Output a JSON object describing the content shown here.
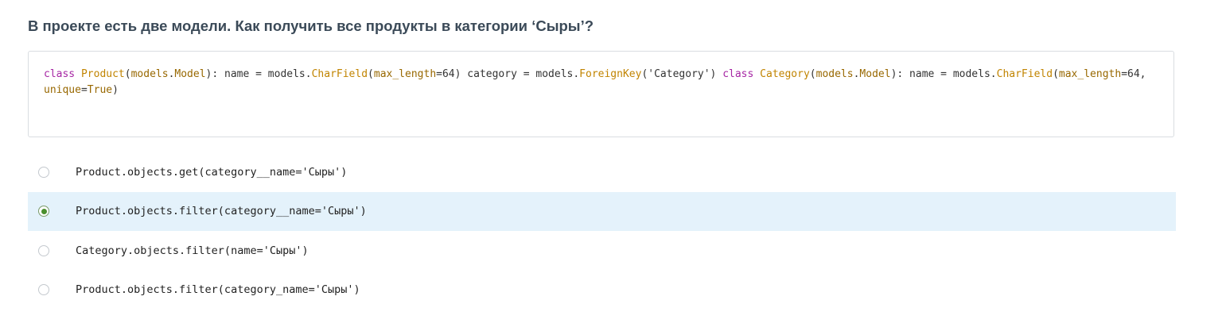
{
  "question": {
    "title": "В проекте есть две модели. Как получить все продукты в категории ‘Сыры’?"
  },
  "code": {
    "tokens": [
      {
        "t": "class",
        "k": "keyword"
      },
      {
        "t": " ",
        "k": "plain"
      },
      {
        "t": "Product",
        "k": "class"
      },
      {
        "t": "(",
        "k": "plain"
      },
      {
        "t": "models",
        "k": "module"
      },
      {
        "t": ".",
        "k": "plain"
      },
      {
        "t": "Model",
        "k": "module"
      },
      {
        "t": "): name = models.",
        "k": "plain"
      },
      {
        "t": "CharField",
        "k": "call"
      },
      {
        "t": "(",
        "k": "plain"
      },
      {
        "t": "max_length",
        "k": "param"
      },
      {
        "t": "=64) category = models.",
        "k": "plain"
      },
      {
        "t": "ForeignKey",
        "k": "call"
      },
      {
        "t": "('Category') ",
        "k": "plain"
      },
      {
        "t": "class",
        "k": "keyword"
      },
      {
        "t": " ",
        "k": "plain"
      },
      {
        "t": "Category",
        "k": "class"
      },
      {
        "t": "(",
        "k": "plain"
      },
      {
        "t": "models",
        "k": "module"
      },
      {
        "t": ".",
        "k": "plain"
      },
      {
        "t": "Model",
        "k": "module"
      },
      {
        "t": "): name = models.",
        "k": "plain"
      },
      {
        "t": "CharField",
        "k": "call"
      },
      {
        "t": "(",
        "k": "plain"
      },
      {
        "t": "max_length",
        "k": "param"
      },
      {
        "t": "=64, ",
        "k": "plain"
      },
      {
        "t": "unique",
        "k": "param"
      },
      {
        "t": "=",
        "k": "plain"
      },
      {
        "t": "True",
        "k": "module"
      },
      {
        "t": ")",
        "k": "plain"
      }
    ]
  },
  "options": [
    {
      "label": "Product.objects.get(category__name='Сыры')",
      "selected": false
    },
    {
      "label": "Product.objects.filter(category__name='Сыры')",
      "selected": true
    },
    {
      "label": "Category.objects.filter(name='Сыры')",
      "selected": false
    },
    {
      "label": "Product.objects.filter(category_name='Сыры')",
      "selected": false
    }
  ],
  "colors": {
    "selected_background": "#e4f2fb",
    "radio_selected": "#4a8f2e",
    "title_text": "#3b4a58"
  }
}
